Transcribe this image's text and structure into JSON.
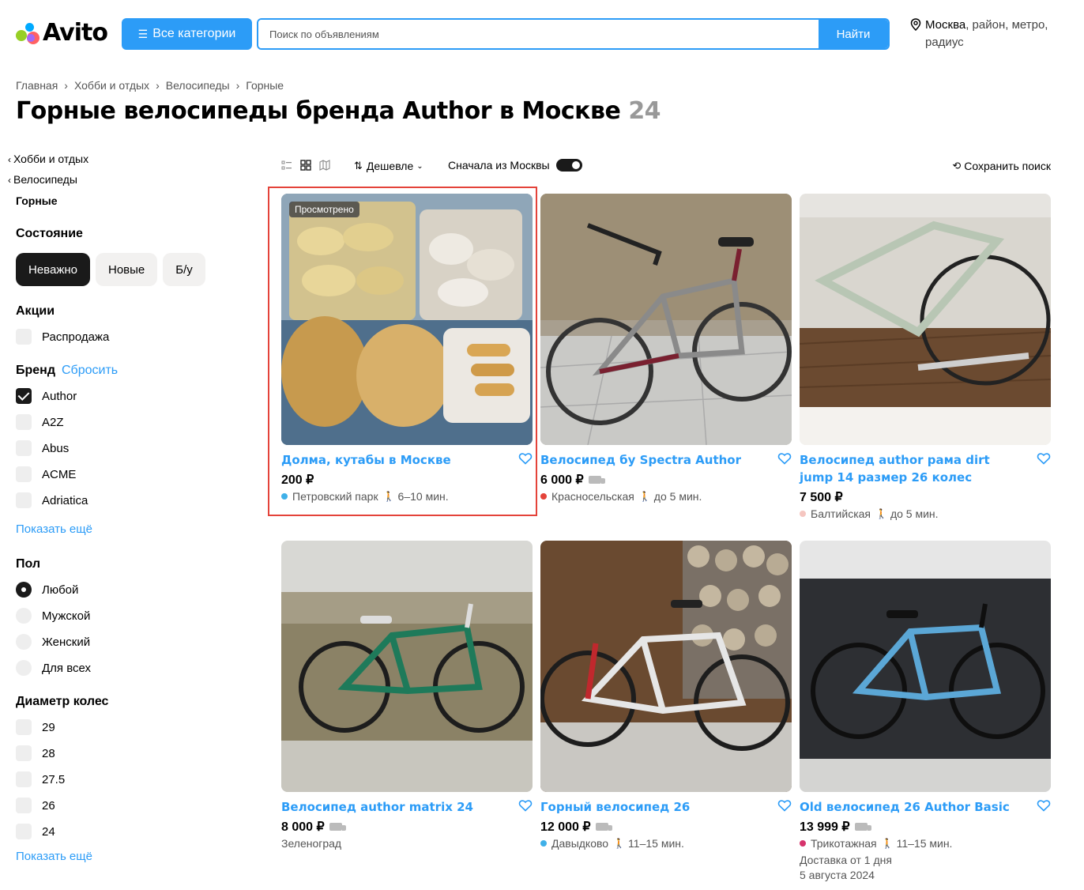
{
  "header": {
    "logo_text": "Avito",
    "categories_button": "Все категории",
    "search_placeholder": "Поиск по объявлениям",
    "search_button": "Найти",
    "location_city": "Москва",
    "location_rest": ", район, метро, радиус"
  },
  "breadcrumb": [
    "Главная",
    "Хобби и отдых",
    "Велосипеды",
    "Горные"
  ],
  "page_title": "Горные велосипеды бренда Author в Москве",
  "page_count": "24",
  "sidebar": {
    "back_links": [
      "Хобби и отдых",
      "Велосипеды"
    ],
    "current": "Горные",
    "condition_title": "Состояние",
    "condition_options": [
      "Неважно",
      "Новые",
      "Б/у"
    ],
    "promo_title": "Акции",
    "promo_items": [
      "Распродажа"
    ],
    "brand_title": "Бренд",
    "brand_reset": "Сбросить",
    "brands": [
      "Author",
      "A2Z",
      "Abus",
      "ACME",
      "Adriatica"
    ],
    "show_more": "Показать ещё",
    "gender_title": "Пол",
    "genders": [
      "Любой",
      "Мужской",
      "Женский",
      "Для всех"
    ],
    "wheel_title": "Диаметр колес",
    "wheels": [
      "29",
      "28",
      "27.5",
      "26",
      "24"
    ],
    "show_more_2": "Показать ещё"
  },
  "toolbar": {
    "sort_label": "Дешевле",
    "moscow_first": "Сначала из Москвы",
    "save_search": "Сохранить поиск"
  },
  "listings": [
    {
      "title": "Долма, кутабы в Москве",
      "price": "200 ₽",
      "station": "Петровский парк",
      "walk": "6–10 мин.",
      "badge": "Просмотрено",
      "dot": "#3fb0e8"
    },
    {
      "title": "Велосипед бу Spectra Author",
      "price": "6 000 ₽",
      "station": "Красносельская",
      "walk": "до 5 мин.",
      "dot": "#e4433a"
    },
    {
      "title": "Велосипед author рама dirt jump 14 размер 26 колес",
      "price": "7 500 ₽",
      "station": "Балтийская",
      "walk": "до 5 мин.",
      "dot": "#f5c6c0"
    },
    {
      "title": "Велосипед author matrix 24",
      "price": "8 000 ₽",
      "station": "Зеленоград"
    },
    {
      "title": "Горный велосипед 26",
      "price": "12 000 ₽",
      "station": "Давыдково",
      "walk": "11–15 мин.",
      "dot": "#3fb0e8"
    },
    {
      "title": "Old велосипед 26 Author Basic",
      "price": "13 999 ₽",
      "station": "Трикотажная",
      "walk": "11–15 мин.",
      "dot": "#d6336c",
      "delivery": "Доставка от 1 дня",
      "date": "5 августа 2024"
    }
  ]
}
